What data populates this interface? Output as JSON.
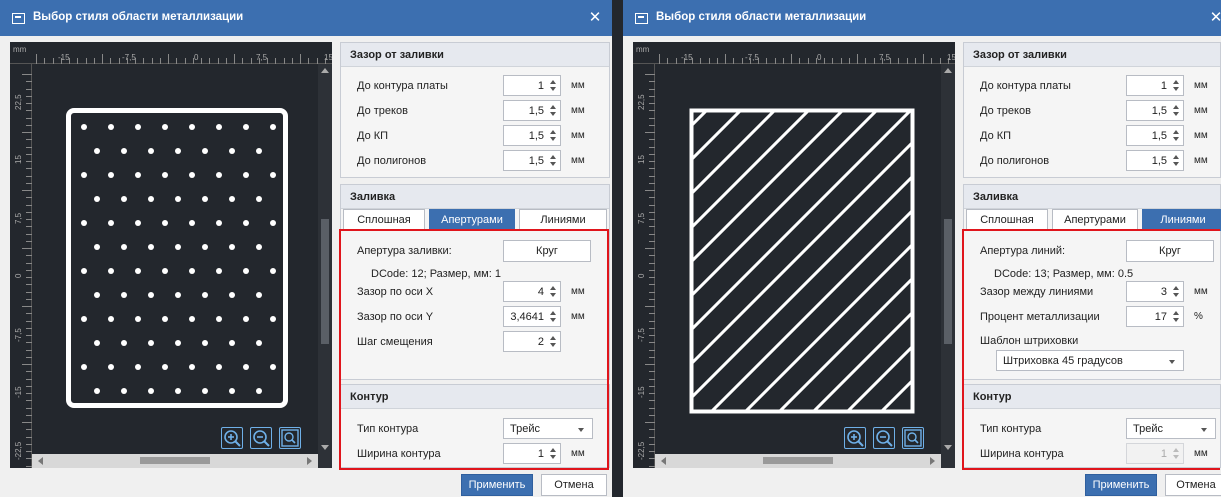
{
  "colors": {
    "accent": "#3c6fb0",
    "highlight": "#e0151c",
    "canvas": "#23272d"
  },
  "left": {
    "title": "Выбор стиля области металлизации",
    "preview": {
      "ruler_unit": "mm",
      "x_ticks": [
        "-15",
        "-7,5",
        "0",
        "7,5",
        "15"
      ],
      "y_ticks": [
        "22,5",
        "15",
        "7,5",
        "0",
        "-7,5",
        "-15",
        "-22,5"
      ],
      "fill_pattern": "dots"
    },
    "clearance": {
      "header": "Зазор от заливки",
      "rows": [
        {
          "label": "До контура платы",
          "value": "1",
          "unit": "мм"
        },
        {
          "label": "До треков",
          "value": "1,5",
          "unit": "мм"
        },
        {
          "label": "До КП",
          "value": "1,5",
          "unit": "мм"
        },
        {
          "label": "До полигонов",
          "value": "1,5",
          "unit": "мм"
        }
      ]
    },
    "fill": {
      "header": "Заливка",
      "tabs": [
        "Сплошная",
        "Апертурами",
        "Линиями"
      ],
      "active_tab": "Апертурами",
      "aperture_label": "Апертура заливки:",
      "aperture_button": "Круг",
      "dcode": "DCode: 12; Размер, мм: 1",
      "rows": [
        {
          "label": "Зазор по оси X",
          "value": "4",
          "unit": "мм"
        },
        {
          "label": "Зазор по оси Y",
          "value": "3,4641",
          "unit": "мм"
        },
        {
          "label": "Шаг смещения",
          "value": "2",
          "unit": ""
        }
      ]
    },
    "contour": {
      "header": "Контур",
      "type_label": "Тип контура",
      "type_value": "Трейс",
      "width_label": "Ширина контура",
      "width_value": "1",
      "width_unit": "мм"
    },
    "apply": "Применить",
    "cancel": "Отмена"
  },
  "right": {
    "title": "Выбор стиля области металлизации",
    "preview": {
      "ruler_unit": "mm",
      "x_ticks": [
        "-15",
        "-7,5",
        "0",
        "7,5",
        "15"
      ],
      "y_ticks": [
        "22,5",
        "15",
        "7,5",
        "0",
        "-7,5",
        "-15",
        "-22,5"
      ],
      "fill_pattern": "hatch-45"
    },
    "clearance": {
      "header": "Зазор от заливки",
      "rows": [
        {
          "label": "До контура платы",
          "value": "1",
          "unit": "мм"
        },
        {
          "label": "До треков",
          "value": "1,5",
          "unit": "мм"
        },
        {
          "label": "До КП",
          "value": "1,5",
          "unit": "мм"
        },
        {
          "label": "До полигонов",
          "value": "1,5",
          "unit": "мм"
        }
      ]
    },
    "fill": {
      "header": "Заливка",
      "tabs": [
        "Сплошная",
        "Апертурами",
        "Линиями"
      ],
      "active_tab": "Линиями",
      "aperture_label": "Апертура линий:",
      "aperture_button": "Круг",
      "dcode": "DCode: 13; Размер, мм: 0.5",
      "rows": [
        {
          "label": "Зазор между линиями",
          "value": "3",
          "unit": "мм"
        },
        {
          "label": "Процент металлизации",
          "value": "17",
          "unit": "%"
        }
      ],
      "pattern_label": "Шаблон штриховки",
      "pattern_value": "Штриховка 45 градусов"
    },
    "contour": {
      "header": "Контур",
      "type_label": "Тип контура",
      "type_value": "Трейс",
      "width_label": "Ширина контура",
      "width_value": "1",
      "width_unit": "мм"
    },
    "apply": "Применить",
    "cancel": "Отмена"
  }
}
